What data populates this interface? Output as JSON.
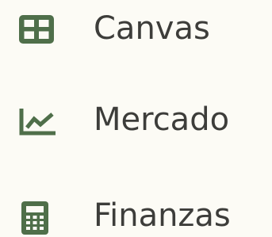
{
  "accent_color": "#4f6f4a",
  "text_color": "#3d3d3a",
  "background_color": "#fcfbf5",
  "nav": {
    "items": [
      {
        "label": "Canvas",
        "icon": "grid-icon"
      },
      {
        "label": "Mercado",
        "icon": "trending-chart-icon"
      },
      {
        "label": "Finanzas",
        "icon": "calculator-icon"
      }
    ]
  }
}
